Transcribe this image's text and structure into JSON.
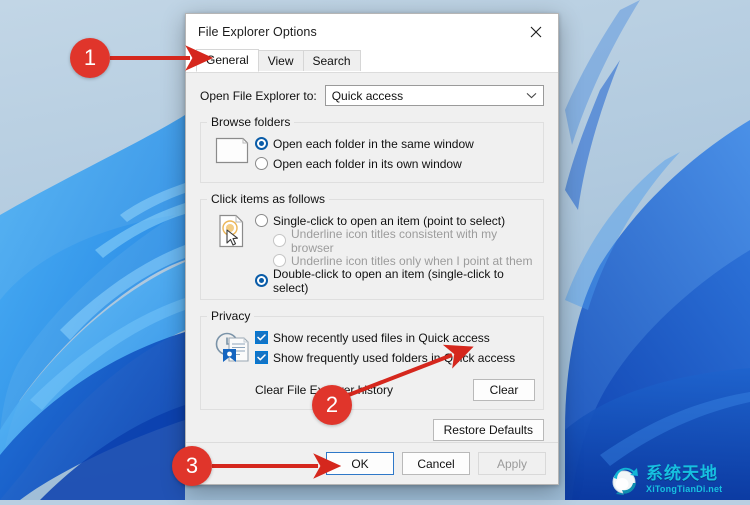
{
  "desktop": {
    "wallpaper_name": "windows-11-bloom-wallpaper",
    "colors": {
      "sky_top": "#bcd2e4",
      "sky_bottom": "#a9c6de",
      "bloom_light": "#35a0ef",
      "bloom_mid": "#1877dd",
      "bloom_deep": "#0d4fc0"
    }
  },
  "dialog": {
    "title": "File Explorer Options",
    "close_icon": "close-icon",
    "tabs": [
      {
        "label": "General",
        "active": true
      },
      {
        "label": "View",
        "active": false
      },
      {
        "label": "Search",
        "active": false
      }
    ],
    "open_to": {
      "label": "Open File Explorer to:",
      "value": "Quick access",
      "chevron_icon": "chevron-down-icon"
    },
    "browse_folders": {
      "legend": "Browse folders",
      "icon": "folder-window-icon",
      "options": [
        {
          "label": "Open each folder in the same window",
          "checked": true,
          "disabled": false
        },
        {
          "label": "Open each folder in its own window",
          "checked": false,
          "disabled": false
        }
      ]
    },
    "click_items": {
      "legend": "Click items as follows",
      "icon": "click-pointer-icon",
      "options": [
        {
          "label": "Single-click to open an item (point to select)",
          "checked": false,
          "disabled": false,
          "sub": false
        },
        {
          "label": "Underline icon titles consistent with my browser",
          "checked": false,
          "disabled": true,
          "sub": true
        },
        {
          "label": "Underline icon titles only when I point at them",
          "checked": false,
          "disabled": true,
          "sub": true
        },
        {
          "label": "Double-click to open an item (single-click to select)",
          "checked": true,
          "disabled": false,
          "sub": false
        }
      ]
    },
    "privacy": {
      "legend": "Privacy",
      "icon": "privacy-history-icon",
      "checkboxes": [
        {
          "label": "Show recently used files in Quick access",
          "checked": true
        },
        {
          "label": "Show frequently used folders in Quick access",
          "checked": true
        }
      ],
      "clear_row": {
        "label": "Clear File Explorer history",
        "button": "Clear"
      }
    },
    "restore_defaults_button": "Restore Defaults",
    "footer": {
      "ok": "OK",
      "cancel": "Cancel",
      "apply": "Apply",
      "apply_disabled": true
    }
  },
  "annotations": {
    "color": "#e0352b",
    "markers": [
      {
        "number": "1",
        "target": "general-tab"
      },
      {
        "number": "2",
        "target": "clear-button"
      },
      {
        "number": "3",
        "target": "ok-button"
      }
    ]
  },
  "watermark": {
    "cn": "系统天地",
    "en": "XiTongTianDi.net",
    "logo_icon": "recycle-globe-logo-icon",
    "color": "#16c0e0"
  }
}
